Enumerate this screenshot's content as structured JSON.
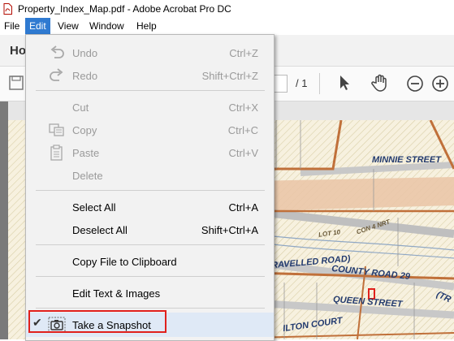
{
  "window": {
    "title": "Property_Index_Map.pdf - Adobe Acrobat Pro DC"
  },
  "menubar": {
    "items": [
      "File",
      "Edit",
      "View",
      "Window",
      "Help"
    ]
  },
  "tabs": {
    "home": "Ho"
  },
  "toolbar": {
    "page_separator": "/ 1"
  },
  "edit_menu": {
    "items": [
      {
        "label": "Undo",
        "shortcut": "Ctrl+Z",
        "enabled": false,
        "icon": "undo-icon"
      },
      {
        "label": "Redo",
        "shortcut": "Shift+Ctrl+Z",
        "enabled": false,
        "icon": "redo-icon"
      },
      {
        "label": "Cut",
        "shortcut": "Ctrl+X",
        "enabled": false
      },
      {
        "label": "Copy",
        "shortcut": "Ctrl+C",
        "enabled": false,
        "icon": "copy-icon"
      },
      {
        "label": "Paste",
        "shortcut": "Ctrl+V",
        "enabled": false,
        "icon": "paste-icon"
      },
      {
        "label": "Delete",
        "shortcut": "",
        "enabled": false
      },
      {
        "label": "Select All",
        "shortcut": "Ctrl+A",
        "enabled": true
      },
      {
        "label": "Deselect All",
        "shortcut": "Shift+Ctrl+A",
        "enabled": true
      },
      {
        "label": "Copy File to Clipboard",
        "shortcut": "",
        "enabled": true
      },
      {
        "label": "Edit Text & Images",
        "shortcut": "",
        "enabled": true
      },
      {
        "label": "Take a Snapshot",
        "shortcut": "",
        "enabled": true,
        "checked": true,
        "icon": "camera-icon"
      }
    ]
  },
  "map": {
    "labels": [
      "MINNIE STREET",
      "LOT 10",
      "CON 4 NRT",
      "RAVELLED ROAD)",
      "COUNTY ROAD 29",
      "QUEEN STREET",
      "ILTON COURT",
      "(TR"
    ]
  },
  "colors": {
    "menu_highlight": "#2f7ad1",
    "snapshot_outline": "#e0201c",
    "road": "#c0703a"
  }
}
